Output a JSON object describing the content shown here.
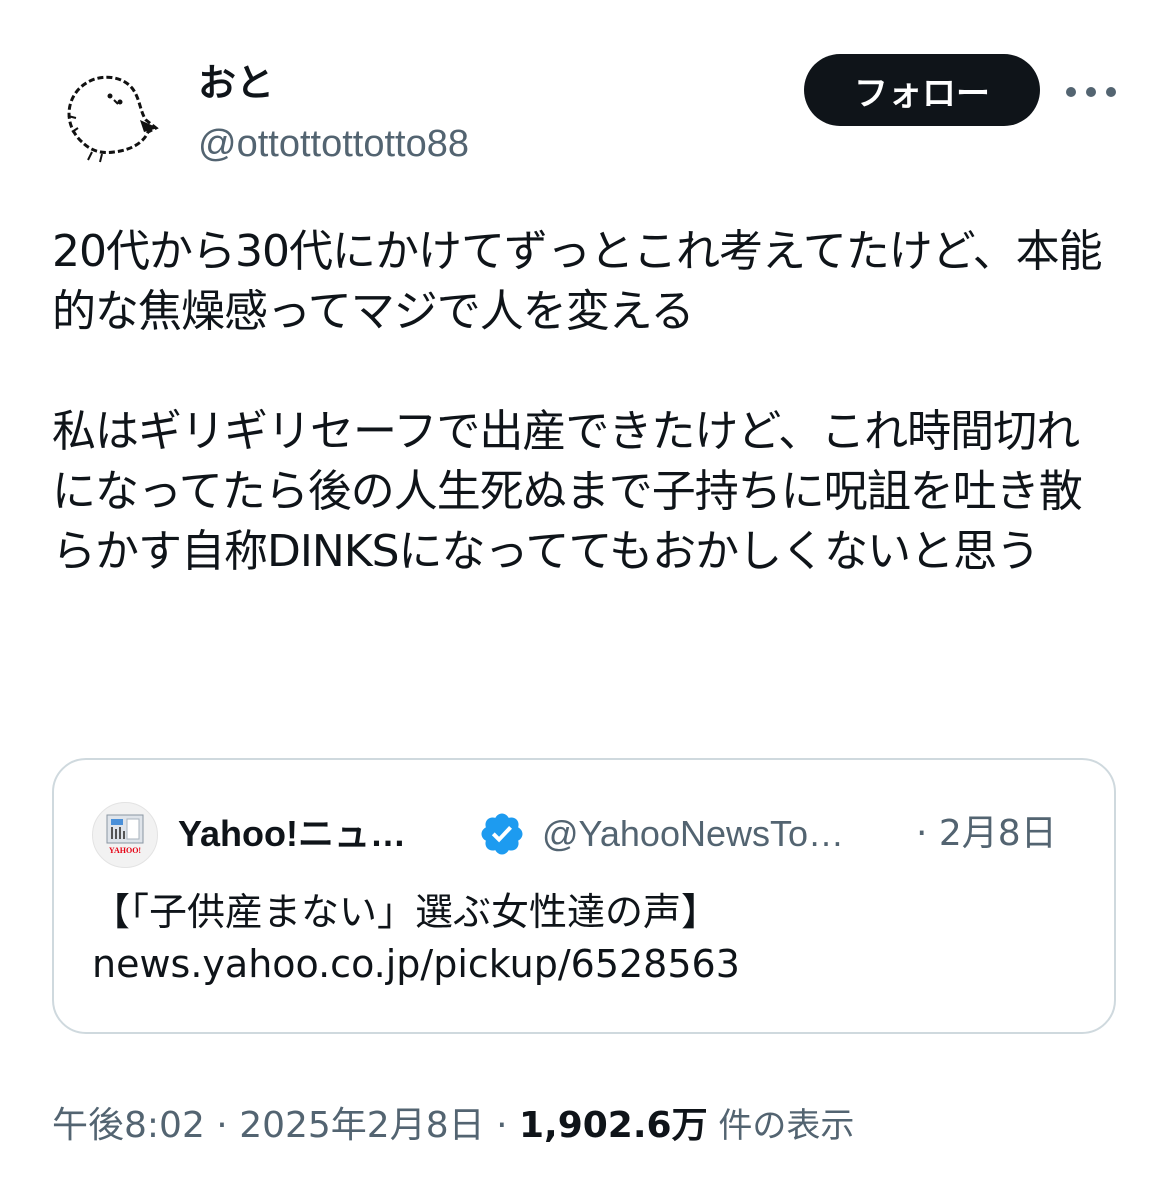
{
  "author": {
    "display_name": "おと",
    "handle": "@ottottottotto88",
    "avatar_icon": "white-bird-doodle-icon"
  },
  "follow_button": {
    "label": "フォロー"
  },
  "more_menu": {
    "icon": "more-horizontal-icon"
  },
  "tweet": {
    "text": "20代から30代にかけてずっとこれ考えてたけど、本能的な焦燥感ってマジで人を変える\n\n私はギリギリセーフで出産できたけど、これ時間切れになってたら後の人生死ぬまで子持ちに呪詛を吐き散らかす自称DINKSになっててもおかしくないと思う"
  },
  "quote": {
    "avatar_icon": "yahoo-news-logo-icon",
    "avatar_text": "YAHOO!",
    "display_name": "Yahoo!ニュ…",
    "verified_icon": "verified-badge-icon",
    "handle": "@YahooNewsTo…",
    "date": "· 2月8日",
    "text_line1": "【「子供産まない」選ぶ女性達の声】",
    "text_line2": "news.yahoo.co.jp/pickup/6528563"
  },
  "meta": {
    "time": "午後8:02",
    "sep1": " · ",
    "date": "2025年2月8日",
    "sep2": " · ",
    "views_count": "1,902.6万",
    "views_label": " 件の表示"
  },
  "colors": {
    "text": "#0f1419",
    "secondary": "#536471",
    "border": "#cfd9de",
    "verified": "#1d9bf0",
    "follow_bg": "#0f1419"
  }
}
